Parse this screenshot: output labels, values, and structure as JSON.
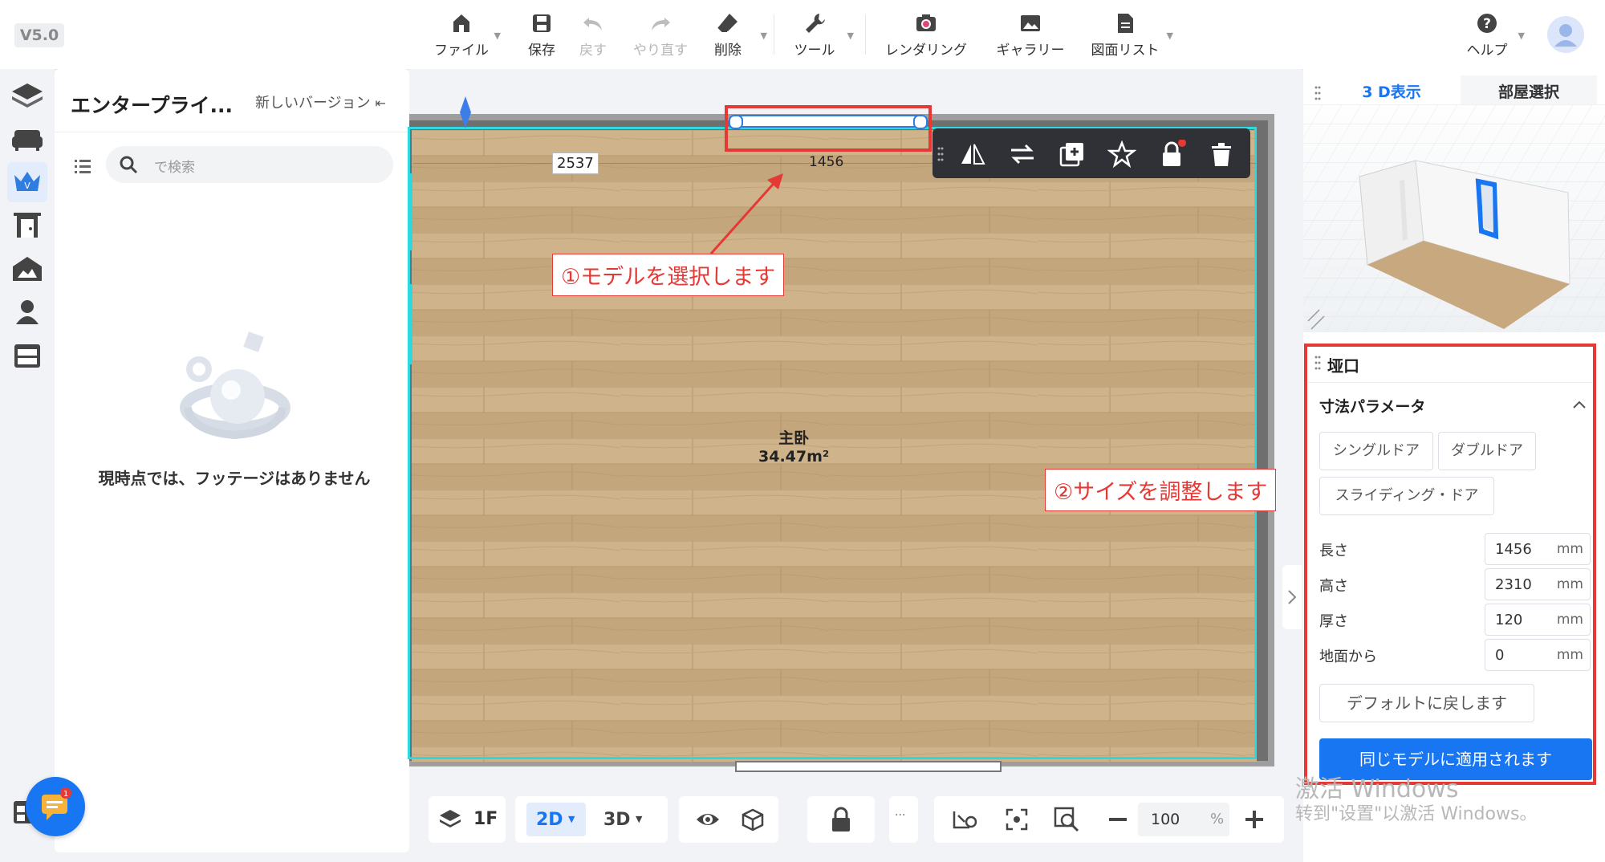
{
  "app": {
    "version": "V5.0"
  },
  "toolbar": {
    "file": "ファイル",
    "save": "保存",
    "undo": "戻す",
    "redo": "やり直す",
    "delete": "削除",
    "tools": "ツール",
    "rendering": "レンダリング",
    "gallery": "ギャラリー",
    "drawing_list": "図面リスト",
    "help": "ヘルプ"
  },
  "side_panel": {
    "title": "エンタープライ...",
    "new_version": "新しいバージョン",
    "search_placeholder": "で検索",
    "empty_message": "現時点では、フッテージはありません"
  },
  "canvas": {
    "room_name": "主卧",
    "room_area": "34.47m²",
    "dim_left": "2537",
    "dim_opening": "1456"
  },
  "annotations": {
    "step1": "①モデルを選択します",
    "step2": "②サイズを調整します"
  },
  "right_panel": {
    "tab_3d": "3 D表示",
    "tab_room": "部屋選択",
    "section_title": "垭口",
    "dimension_header": "寸法パラメータ",
    "type_buttons": [
      "シングルドア",
      "ダブルドア",
      "スライディング・ドア"
    ],
    "params": [
      {
        "label": "長さ",
        "value": "1456",
        "unit": "mm"
      },
      {
        "label": "高さ",
        "value": "2310",
        "unit": "mm"
      },
      {
        "label": "厚さ",
        "value": "120",
        "unit": "mm"
      },
      {
        "label": "地面から",
        "value": "0",
        "unit": "mm"
      }
    ],
    "reset_button": "デフォルトに戻します",
    "apply_button": "同じモデルに適用されます"
  },
  "bottom_bar": {
    "floor": "1F",
    "view_2d": "2D",
    "view_3d": "3D",
    "more": "···",
    "zoom_value": "100",
    "zoom_unit": "%"
  },
  "watermark": {
    "line1": "激活 Windows",
    "line2": "转到\"设置\"以激活 Windows。"
  },
  "colors": {
    "accent": "#1976f2",
    "annotation": "#e53935",
    "wall_outline": "#2ed8e0"
  }
}
